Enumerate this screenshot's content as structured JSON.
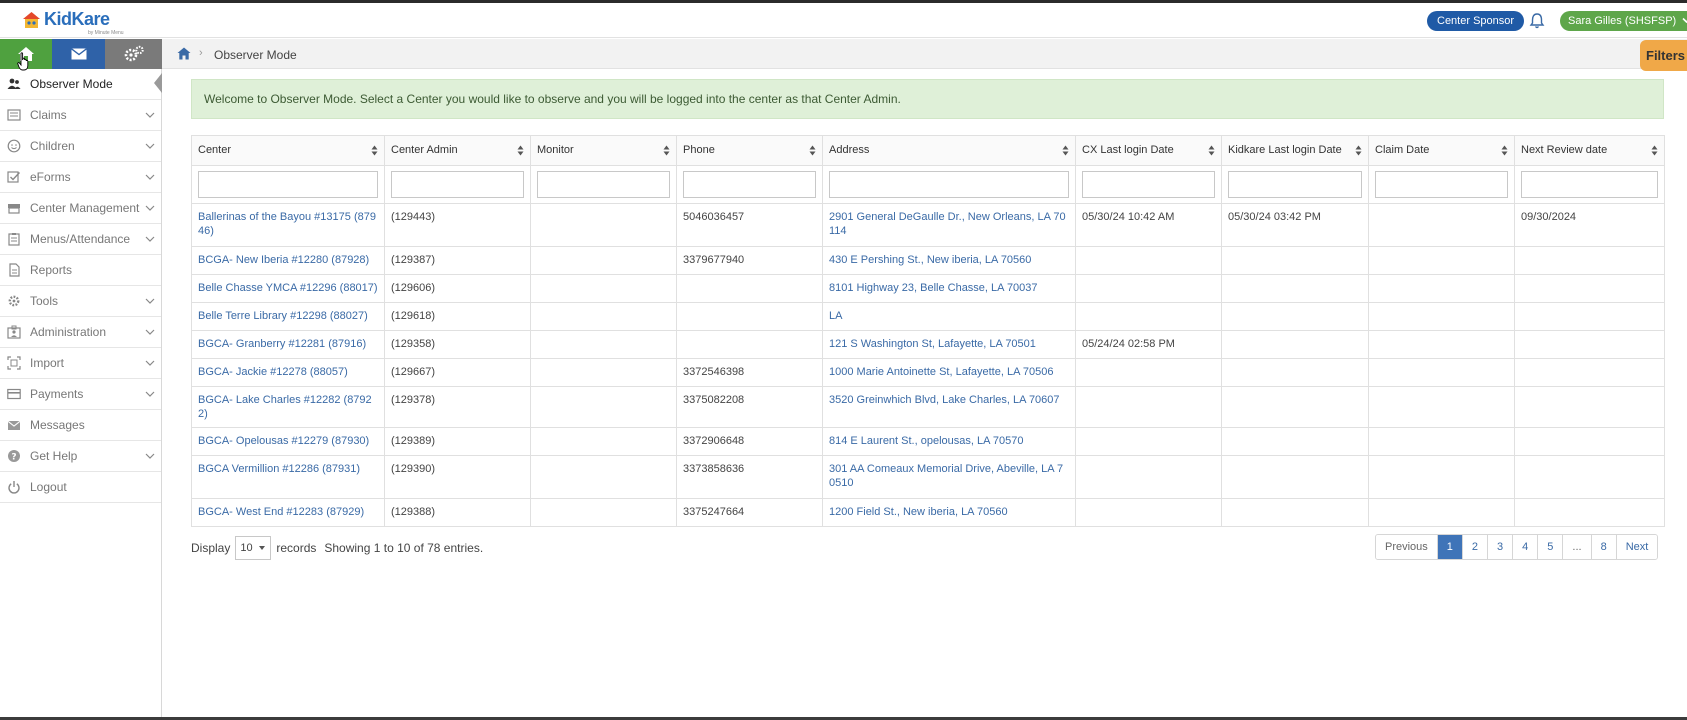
{
  "brand": {
    "name": "KidKare",
    "tagline": "by Minute Menu"
  },
  "topbar": {
    "sponsor_button": "Center Sponsor",
    "user_button": "Sara Gilles (SHSFSP)"
  },
  "breadcrumb": {
    "current": "Observer Mode"
  },
  "filters_label": "Filters",
  "sidebar": {
    "items": [
      {
        "label": "Observer Mode",
        "icon": "users-icon",
        "active": true,
        "expandable": false
      },
      {
        "label": "Claims",
        "icon": "claims-icon",
        "expandable": true
      },
      {
        "label": "Children",
        "icon": "child-face-icon",
        "expandable": true
      },
      {
        "label": "eForms",
        "icon": "checkbox-icon",
        "expandable": true
      },
      {
        "label": "Center Management",
        "icon": "building-icon",
        "expandable": true
      },
      {
        "label": "Menus/Attendance",
        "icon": "clipboard-icon",
        "expandable": true
      },
      {
        "label": "Reports",
        "icon": "document-icon",
        "expandable": false
      },
      {
        "label": "Tools",
        "icon": "cog-icon",
        "expandable": true
      },
      {
        "label": "Administration",
        "icon": "id-badge-icon",
        "expandable": true
      },
      {
        "label": "Import",
        "icon": "import-icon",
        "expandable": true
      },
      {
        "label": "Payments",
        "icon": "credit-card-icon",
        "expandable": true
      },
      {
        "label": "Messages",
        "icon": "envelope-icon",
        "expandable": false
      },
      {
        "label": "Get Help",
        "icon": "question-icon",
        "expandable": true
      },
      {
        "label": "Logout",
        "icon": "power-icon",
        "expandable": false
      }
    ]
  },
  "welcome_text": "Welcome to Observer Mode. Select a Center you would like to observe and you will be logged into the center as that Center Admin.",
  "table": {
    "columns": [
      "Center",
      "Center Admin",
      "Monitor",
      "Phone",
      "Address",
      "CX Last login Date",
      "Kidkare Last login Date",
      "Claim Date",
      "Next Review date"
    ],
    "rows": [
      [
        "Ballerinas of the Bayou #13175 (87946)",
        "(129443)",
        "",
        "5046036457",
        "2901 General DeGaulle Dr., New Orleans, LA 70114",
        "05/30/24 10:42 AM",
        "05/30/24 03:42 PM",
        "",
        "09/30/2024"
      ],
      [
        "BCGA- New Iberia #12280 (87928)",
        "(129387)",
        "",
        "3379677940",
        "430 E Pershing St., New iberia, LA 70560",
        "",
        "",
        "",
        ""
      ],
      [
        "Belle Chasse YMCA #12296 (88017)",
        "(129606)",
        "",
        "",
        "8101 Highway 23, Belle Chasse, LA 70037",
        "",
        "",
        "",
        ""
      ],
      [
        "Belle Terre Library #12298 (88027)",
        "(129618)",
        "",
        "",
        "LA",
        "",
        "",
        "",
        ""
      ],
      [
        "BGCA- Granberry #12281 (87916)",
        "(129358)",
        "",
        "",
        "121 S Washington St, Lafayette, LA 70501",
        "05/24/24 02:58 PM",
        "",
        "",
        ""
      ],
      [
        "BGCA- Jackie #12278 (88057)",
        "(129667)",
        "",
        "3372546398",
        "1000 Marie Antoinette St, Lafayette, LA 70506",
        "",
        "",
        "",
        ""
      ],
      [
        "BGCA- Lake Charles #12282 (87922)",
        "(129378)",
        "",
        "3375082208",
        "3520 Greinwhich Blvd, Lake Charles, LA 70607",
        "",
        "",
        "",
        ""
      ],
      [
        "BGCA- Opelousas #12279 (87930)",
        "(129389)",
        "",
        "3372906648",
        "814 E Laurent St., opelousas, LA 70570",
        "",
        "",
        "",
        ""
      ],
      [
        "BGCA Vermillion #12286 (87931)",
        "(129390)",
        "",
        "3373858636",
        "301 AA Comeaux Memorial Drive, Abeville, LA 70510",
        "",
        "",
        "",
        ""
      ],
      [
        "BGCA- West End #12283 (87929)",
        "(129388)",
        "",
        "3375247664",
        "1200 Field St., New iberia, LA 70560",
        "",
        "",
        "",
        ""
      ]
    ]
  },
  "footer": {
    "display_label": "Display",
    "page_size": "10",
    "records_label": "records",
    "showing_text": "Showing 1 to 10 of 78 entries."
  },
  "pagination": {
    "pages": [
      "Previous",
      "1",
      "2",
      "3",
      "4",
      "5",
      "...",
      "8",
      "Next"
    ],
    "active": "1"
  }
}
